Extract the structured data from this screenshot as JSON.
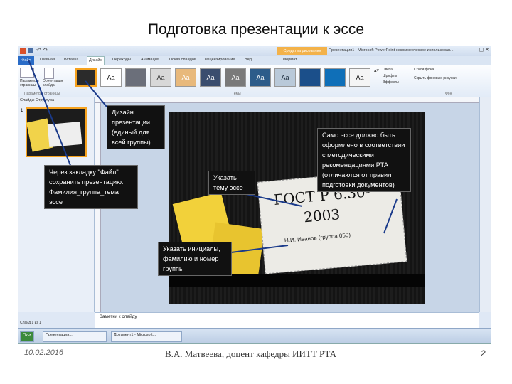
{
  "slide_title": "Подготовка презентации к эссе",
  "app": {
    "contextual_tab": "Средства рисования",
    "window_title": "Презентация1 - Microsoft PowerPoint некоммерческое использован...",
    "tabs": [
      "Файл",
      "Главная",
      "Вставка",
      "Дизайн",
      "Переходы",
      "Анимация",
      "Показ слайдов",
      "Рецензирование",
      "Вид",
      "Формат"
    ],
    "ribbon": {
      "page_setup": "Параметры страницы",
      "orientation": "Ориентация слайда",
      "themes_group": "Темы",
      "colors": "Цвета",
      "fonts": "Шрифты",
      "effects": "Эффекты",
      "bg_styles": "Стили фона",
      "hide_bg": "Скрыть фоновые рисунки",
      "bg_group": "Фон",
      "theme_label": "Аа"
    },
    "sidebar_tabs": "Слайды   Структура",
    "slide_number": "1",
    "slide_text": {
      "line1": "ГОСТ Р 6.30-",
      "line2": "2003",
      "author": "Н.И. Иванов (группа 050)"
    },
    "notes_placeholder": "Заметки к слайду",
    "status": "Слайд 1 из 1",
    "taskbar": {
      "start": "Пуск",
      "task1": "Презентация...",
      "task2": "Документ1 - Microsoft..."
    }
  },
  "callouts": {
    "design": "Дизайн презентации (единый для всей группы)",
    "save": "Через закладку \"Файл\" сохранить презентацию: Фамилия_группа_тема эссе",
    "topic": "Указать тему эссе",
    "essay": "Само эссе должно быть оформлено в соответствии с методическими рекомендациями РТА (отличаются от правил подготовки документов)",
    "initials": "Указать инициалы, фамилию и номер группы"
  },
  "footer": {
    "date": "10.02.2016",
    "author": "В.А. Матвеева, доцент кафедры ИИТТ РТА",
    "page": "2"
  },
  "colors": {
    "accent": "#f6a21e",
    "callout_bg": "#111111",
    "ribbon_blue": "#2a6cc7"
  }
}
